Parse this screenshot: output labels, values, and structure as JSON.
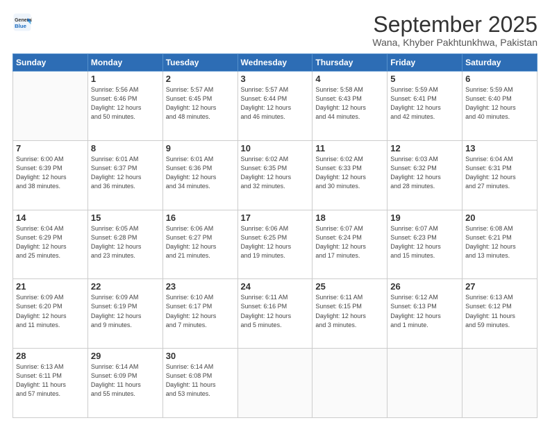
{
  "header": {
    "logo_line1": "General",
    "logo_line2": "Blue",
    "month": "September 2025",
    "location": "Wana, Khyber Pakhtunkhwa, Pakistan"
  },
  "days_of_week": [
    "Sunday",
    "Monday",
    "Tuesday",
    "Wednesday",
    "Thursday",
    "Friday",
    "Saturday"
  ],
  "weeks": [
    [
      {
        "day": "",
        "info": ""
      },
      {
        "day": "1",
        "info": "Sunrise: 5:56 AM\nSunset: 6:46 PM\nDaylight: 12 hours\nand 50 minutes."
      },
      {
        "day": "2",
        "info": "Sunrise: 5:57 AM\nSunset: 6:45 PM\nDaylight: 12 hours\nand 48 minutes."
      },
      {
        "day": "3",
        "info": "Sunrise: 5:57 AM\nSunset: 6:44 PM\nDaylight: 12 hours\nand 46 minutes."
      },
      {
        "day": "4",
        "info": "Sunrise: 5:58 AM\nSunset: 6:43 PM\nDaylight: 12 hours\nand 44 minutes."
      },
      {
        "day": "5",
        "info": "Sunrise: 5:59 AM\nSunset: 6:41 PM\nDaylight: 12 hours\nand 42 minutes."
      },
      {
        "day": "6",
        "info": "Sunrise: 5:59 AM\nSunset: 6:40 PM\nDaylight: 12 hours\nand 40 minutes."
      }
    ],
    [
      {
        "day": "7",
        "info": "Sunrise: 6:00 AM\nSunset: 6:39 PM\nDaylight: 12 hours\nand 38 minutes."
      },
      {
        "day": "8",
        "info": "Sunrise: 6:01 AM\nSunset: 6:37 PM\nDaylight: 12 hours\nand 36 minutes."
      },
      {
        "day": "9",
        "info": "Sunrise: 6:01 AM\nSunset: 6:36 PM\nDaylight: 12 hours\nand 34 minutes."
      },
      {
        "day": "10",
        "info": "Sunrise: 6:02 AM\nSunset: 6:35 PM\nDaylight: 12 hours\nand 32 minutes."
      },
      {
        "day": "11",
        "info": "Sunrise: 6:02 AM\nSunset: 6:33 PM\nDaylight: 12 hours\nand 30 minutes."
      },
      {
        "day": "12",
        "info": "Sunrise: 6:03 AM\nSunset: 6:32 PM\nDaylight: 12 hours\nand 28 minutes."
      },
      {
        "day": "13",
        "info": "Sunrise: 6:04 AM\nSunset: 6:31 PM\nDaylight: 12 hours\nand 27 minutes."
      }
    ],
    [
      {
        "day": "14",
        "info": "Sunrise: 6:04 AM\nSunset: 6:29 PM\nDaylight: 12 hours\nand 25 minutes."
      },
      {
        "day": "15",
        "info": "Sunrise: 6:05 AM\nSunset: 6:28 PM\nDaylight: 12 hours\nand 23 minutes."
      },
      {
        "day": "16",
        "info": "Sunrise: 6:06 AM\nSunset: 6:27 PM\nDaylight: 12 hours\nand 21 minutes."
      },
      {
        "day": "17",
        "info": "Sunrise: 6:06 AM\nSunset: 6:25 PM\nDaylight: 12 hours\nand 19 minutes."
      },
      {
        "day": "18",
        "info": "Sunrise: 6:07 AM\nSunset: 6:24 PM\nDaylight: 12 hours\nand 17 minutes."
      },
      {
        "day": "19",
        "info": "Sunrise: 6:07 AM\nSunset: 6:23 PM\nDaylight: 12 hours\nand 15 minutes."
      },
      {
        "day": "20",
        "info": "Sunrise: 6:08 AM\nSunset: 6:21 PM\nDaylight: 12 hours\nand 13 minutes."
      }
    ],
    [
      {
        "day": "21",
        "info": "Sunrise: 6:09 AM\nSunset: 6:20 PM\nDaylight: 12 hours\nand 11 minutes."
      },
      {
        "day": "22",
        "info": "Sunrise: 6:09 AM\nSunset: 6:19 PM\nDaylight: 12 hours\nand 9 minutes."
      },
      {
        "day": "23",
        "info": "Sunrise: 6:10 AM\nSunset: 6:17 PM\nDaylight: 12 hours\nand 7 minutes."
      },
      {
        "day": "24",
        "info": "Sunrise: 6:11 AM\nSunset: 6:16 PM\nDaylight: 12 hours\nand 5 minutes."
      },
      {
        "day": "25",
        "info": "Sunrise: 6:11 AM\nSunset: 6:15 PM\nDaylight: 12 hours\nand 3 minutes."
      },
      {
        "day": "26",
        "info": "Sunrise: 6:12 AM\nSunset: 6:13 PM\nDaylight: 12 hours\nand 1 minute."
      },
      {
        "day": "27",
        "info": "Sunrise: 6:13 AM\nSunset: 6:12 PM\nDaylight: 11 hours\nand 59 minutes."
      }
    ],
    [
      {
        "day": "28",
        "info": "Sunrise: 6:13 AM\nSunset: 6:11 PM\nDaylight: 11 hours\nand 57 minutes."
      },
      {
        "day": "29",
        "info": "Sunrise: 6:14 AM\nSunset: 6:09 PM\nDaylight: 11 hours\nand 55 minutes."
      },
      {
        "day": "30",
        "info": "Sunrise: 6:14 AM\nSunset: 6:08 PM\nDaylight: 11 hours\nand 53 minutes."
      },
      {
        "day": "",
        "info": ""
      },
      {
        "day": "",
        "info": ""
      },
      {
        "day": "",
        "info": ""
      },
      {
        "day": "",
        "info": ""
      }
    ]
  ]
}
